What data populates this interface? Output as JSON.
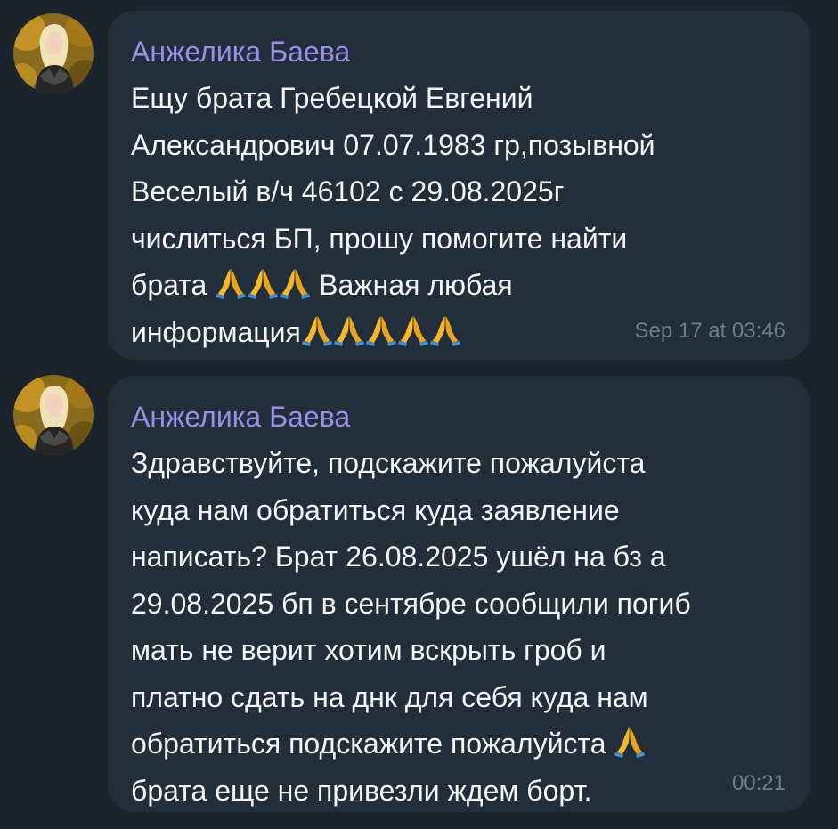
{
  "messages": [
    {
      "sender": "Анжелика Баева",
      "lines": [
        "Ещу  брата Гребецкой Евгений",
        "Александрович 07.07.1983 гр,позывной",
        "Веселый  в/ч 46102 с 29.08.2025г",
        "числиться БП, прошу помогите найти",
        "брата",
        "Важная любая",
        "информация"
      ],
      "time": "Sep 17 at 03:46"
    },
    {
      "sender": "Анжелика Баева",
      "lines": [
        "Здравствуйте, подскажите пожалуйста",
        "куда нам обратиться куда заявление",
        "написать? Брат 26.08.2025 ушёл на бз а",
        "29.08.2025 бп в сентябре сообщили погиб",
        "мать не верит хотим вскрыть гроб и",
        "платно сдать на днк для себя куда нам",
        "обратиться подскажите пожалуйста",
        "брата еще не привезли ждем борт."
      ],
      "time": "00:21"
    }
  ],
  "icons": {
    "emoji": "folded-hands-icon",
    "avatar": "user-photo-avatar"
  },
  "colors": {
    "background": "#1b232d",
    "bubble": "#232e3b",
    "sender": "#9b8ee6",
    "text": "#f4f6f8",
    "time": "#6e7d8c",
    "emoji": "#f5b82a",
    "emoji_cuff": "#3d8fe0"
  }
}
